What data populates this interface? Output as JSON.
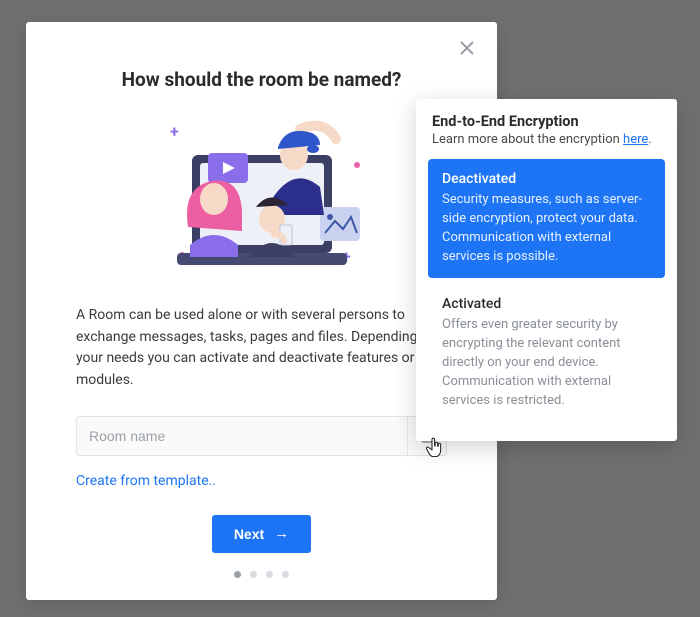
{
  "modal": {
    "title": "How should the room be named?",
    "description": "A Room can be used alone or with several persons to exchange messages, tasks, pages and files. Depending on your needs you can activate and deactivate features or modules.",
    "room_placeholder": "Room name",
    "template_link": "Create from template..",
    "next_label": "Next"
  },
  "popover": {
    "title": "End-to-End Encryption",
    "sub_prefix": "Learn more about the encryption ",
    "sub_link": "here",
    "options": [
      {
        "title": "Deactivated",
        "desc": "Security measures, such as server-side encryption, protect your data. Communication with external services is possible.",
        "selected": true
      },
      {
        "title": "Activated",
        "desc": "Offers even greater security by encrypting the relevant content directly on your end device. Communication with external services is restricted.",
        "selected": false
      }
    ]
  },
  "dots": {
    "count": 4,
    "active": 0
  }
}
